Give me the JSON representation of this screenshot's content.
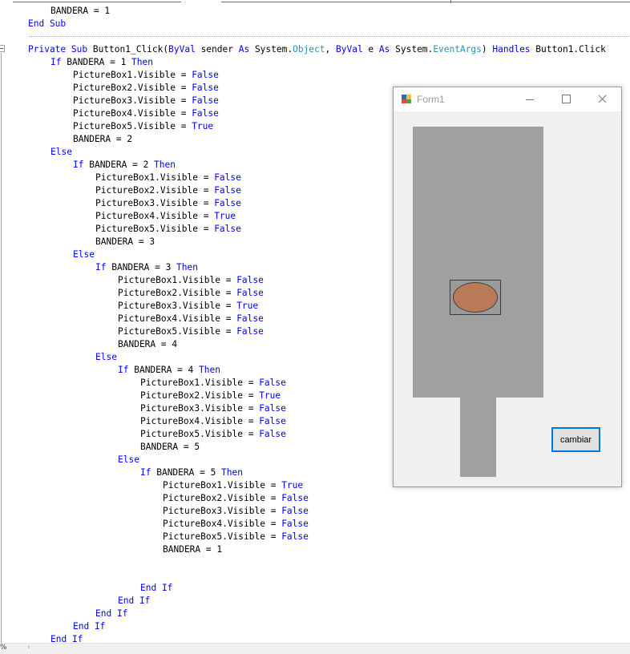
{
  "editor": {
    "lines": [
      {
        "indent": 2,
        "tokens": [
          {
            "t": "BANDERA = 1",
            "c": ""
          }
        ]
      },
      {
        "indent": 1,
        "tokens": [
          {
            "t": "End Sub",
            "c": "kw"
          }
        ]
      },
      {
        "indent": 0,
        "tokens": []
      },
      {
        "indent": 1,
        "tokens": [
          {
            "t": "Private Sub",
            "c": "kw"
          },
          {
            "t": " Button1_Click(",
            "c": ""
          },
          {
            "t": "ByVal",
            "c": "kw"
          },
          {
            "t": " sender ",
            "c": ""
          },
          {
            "t": "As",
            "c": "kw"
          },
          {
            "t": " System.",
            "c": ""
          },
          {
            "t": "Object",
            "c": "ty"
          },
          {
            "t": ", ",
            "c": ""
          },
          {
            "t": "ByVal",
            "c": "kw"
          },
          {
            "t": " e ",
            "c": ""
          },
          {
            "t": "As",
            "c": "kw"
          },
          {
            "t": " System.",
            "c": ""
          },
          {
            "t": "EventArgs",
            "c": "ty"
          },
          {
            "t": ") ",
            "c": ""
          },
          {
            "t": "Handles",
            "c": "kw"
          },
          {
            "t": " Button1.Click",
            "c": ""
          }
        ]
      },
      {
        "indent": 2,
        "tokens": [
          {
            "t": "If",
            "c": "kw"
          },
          {
            "t": " BANDERA = 1 ",
            "c": ""
          },
          {
            "t": "Then",
            "c": "kw"
          }
        ]
      },
      {
        "indent": 3,
        "tokens": [
          {
            "t": "PictureBox1.Visible = ",
            "c": ""
          },
          {
            "t": "False",
            "c": "kw"
          }
        ]
      },
      {
        "indent": 3,
        "tokens": [
          {
            "t": "PictureBox2.Visible = ",
            "c": ""
          },
          {
            "t": "False",
            "c": "kw"
          }
        ]
      },
      {
        "indent": 3,
        "tokens": [
          {
            "t": "PictureBox3.Visible = ",
            "c": ""
          },
          {
            "t": "False",
            "c": "kw"
          }
        ]
      },
      {
        "indent": 3,
        "tokens": [
          {
            "t": "PictureBox4.Visible = ",
            "c": ""
          },
          {
            "t": "False",
            "c": "kw"
          }
        ]
      },
      {
        "indent": 3,
        "tokens": [
          {
            "t": "PictureBox5.Visible = ",
            "c": ""
          },
          {
            "t": "True",
            "c": "kw"
          }
        ]
      },
      {
        "indent": 3,
        "tokens": [
          {
            "t": "BANDERA = 2",
            "c": ""
          }
        ]
      },
      {
        "indent": 2,
        "tokens": [
          {
            "t": "Else",
            "c": "kw"
          }
        ]
      },
      {
        "indent": 3,
        "tokens": [
          {
            "t": "If",
            "c": "kw"
          },
          {
            "t": " BANDERA = 2 ",
            "c": ""
          },
          {
            "t": "Then",
            "c": "kw"
          }
        ]
      },
      {
        "indent": 4,
        "tokens": [
          {
            "t": "PictureBox1.Visible = ",
            "c": ""
          },
          {
            "t": "False",
            "c": "kw"
          }
        ]
      },
      {
        "indent": 4,
        "tokens": [
          {
            "t": "PictureBox2.Visible = ",
            "c": ""
          },
          {
            "t": "False",
            "c": "kw"
          }
        ]
      },
      {
        "indent": 4,
        "tokens": [
          {
            "t": "PictureBox3.Visible = ",
            "c": ""
          },
          {
            "t": "False",
            "c": "kw"
          }
        ]
      },
      {
        "indent": 4,
        "tokens": [
          {
            "t": "PictureBox4.Visible = ",
            "c": ""
          },
          {
            "t": "True",
            "c": "kw"
          }
        ]
      },
      {
        "indent": 4,
        "tokens": [
          {
            "t": "PictureBox5.Visible = ",
            "c": ""
          },
          {
            "t": "False",
            "c": "kw"
          }
        ]
      },
      {
        "indent": 4,
        "tokens": [
          {
            "t": "BANDERA = 3",
            "c": ""
          }
        ]
      },
      {
        "indent": 3,
        "tokens": [
          {
            "t": "Else",
            "c": "kw"
          }
        ]
      },
      {
        "indent": 4,
        "tokens": [
          {
            "t": "If",
            "c": "kw"
          },
          {
            "t": " BANDERA = 3 ",
            "c": ""
          },
          {
            "t": "Then",
            "c": "kw"
          }
        ]
      },
      {
        "indent": 5,
        "tokens": [
          {
            "t": "PictureBox1.Visible = ",
            "c": ""
          },
          {
            "t": "False",
            "c": "kw"
          }
        ]
      },
      {
        "indent": 5,
        "tokens": [
          {
            "t": "PictureBox2.Visible = ",
            "c": ""
          },
          {
            "t": "False",
            "c": "kw"
          }
        ]
      },
      {
        "indent": 5,
        "tokens": [
          {
            "t": "PictureBox3.Visible = ",
            "c": ""
          },
          {
            "t": "True",
            "c": "kw"
          }
        ]
      },
      {
        "indent": 5,
        "tokens": [
          {
            "t": "PictureBox4.Visible = ",
            "c": ""
          },
          {
            "t": "False",
            "c": "kw"
          }
        ]
      },
      {
        "indent": 5,
        "tokens": [
          {
            "t": "PictureBox5.Visible = ",
            "c": ""
          },
          {
            "t": "False",
            "c": "kw"
          }
        ]
      },
      {
        "indent": 5,
        "tokens": [
          {
            "t": "BANDERA = 4",
            "c": ""
          }
        ]
      },
      {
        "indent": 4,
        "tokens": [
          {
            "t": "Else",
            "c": "kw"
          }
        ]
      },
      {
        "indent": 5,
        "tokens": [
          {
            "t": "If",
            "c": "kw"
          },
          {
            "t": " BANDERA = 4 ",
            "c": ""
          },
          {
            "t": "Then",
            "c": "kw"
          }
        ]
      },
      {
        "indent": 6,
        "tokens": [
          {
            "t": "PictureBox1.Visible = ",
            "c": ""
          },
          {
            "t": "False",
            "c": "kw"
          }
        ]
      },
      {
        "indent": 6,
        "tokens": [
          {
            "t": "PictureBox2.Visible = ",
            "c": ""
          },
          {
            "t": "True",
            "c": "kw"
          }
        ]
      },
      {
        "indent": 6,
        "tokens": [
          {
            "t": "PictureBox3.Visible = ",
            "c": ""
          },
          {
            "t": "False",
            "c": "kw"
          }
        ]
      },
      {
        "indent": 6,
        "tokens": [
          {
            "t": "PictureBox4.Visible = ",
            "c": ""
          },
          {
            "t": "False",
            "c": "kw"
          }
        ]
      },
      {
        "indent": 6,
        "tokens": [
          {
            "t": "PictureBox5.Visible = ",
            "c": ""
          },
          {
            "t": "False",
            "c": "kw"
          }
        ]
      },
      {
        "indent": 6,
        "tokens": [
          {
            "t": "BANDERA = 5",
            "c": ""
          }
        ]
      },
      {
        "indent": 5,
        "tokens": [
          {
            "t": "Else",
            "c": "kw"
          }
        ]
      },
      {
        "indent": 6,
        "tokens": [
          {
            "t": "If",
            "c": "kw"
          },
          {
            "t": " BANDERA = 5 ",
            "c": ""
          },
          {
            "t": "Then",
            "c": "kw"
          }
        ]
      },
      {
        "indent": 7,
        "tokens": [
          {
            "t": "PictureBox1.Visible = ",
            "c": ""
          },
          {
            "t": "True",
            "c": "kw"
          }
        ]
      },
      {
        "indent": 7,
        "tokens": [
          {
            "t": "PictureBox2.Visible = ",
            "c": ""
          },
          {
            "t": "False",
            "c": "kw"
          }
        ]
      },
      {
        "indent": 7,
        "tokens": [
          {
            "t": "PictureBox3.Visible = ",
            "c": ""
          },
          {
            "t": "False",
            "c": "kw"
          }
        ]
      },
      {
        "indent": 7,
        "tokens": [
          {
            "t": "PictureBox4.Visible = ",
            "c": ""
          },
          {
            "t": "False",
            "c": "kw"
          }
        ]
      },
      {
        "indent": 7,
        "tokens": [
          {
            "t": "PictureBox5.Visible = ",
            "c": ""
          },
          {
            "t": "False",
            "c": "kw"
          }
        ]
      },
      {
        "indent": 7,
        "tokens": [
          {
            "t": "BANDERA = 1",
            "c": ""
          }
        ]
      },
      {
        "indent": 0,
        "tokens": []
      },
      {
        "indent": 0,
        "tokens": []
      },
      {
        "indent": 6,
        "tokens": [
          {
            "t": "End If",
            "c": "kw"
          }
        ]
      },
      {
        "indent": 5,
        "tokens": [
          {
            "t": "End If",
            "c": "kw"
          }
        ]
      },
      {
        "indent": 4,
        "tokens": [
          {
            "t": "End If",
            "c": "kw"
          }
        ]
      },
      {
        "indent": 3,
        "tokens": [
          {
            "t": "End If",
            "c": "kw"
          }
        ]
      },
      {
        "indent": 2,
        "tokens": [
          {
            "t": "End If",
            "c": "kw"
          }
        ]
      }
    ],
    "colors": {
      "keyword": "#0000ff",
      "type": "#2b91af",
      "text": "#000000"
    },
    "zoom_label": "%",
    "scroll_left_glyph": "‹"
  },
  "form": {
    "title": "Form1",
    "icon": "winforms-app-icon",
    "controls": {
      "minimize_icon": "minimize-icon",
      "maximize_icon": "maximize-icon",
      "close_icon": "close-icon"
    },
    "button_label": "cambiar",
    "colors": {
      "pole": "#a0a0a0",
      "ball": "#b97a57",
      "button_border": "#0078d7",
      "client_bg": "#f0f0f0"
    }
  }
}
